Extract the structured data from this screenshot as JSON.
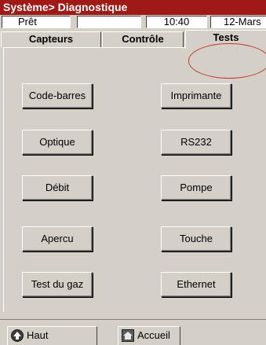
{
  "titlebar": {
    "title": "Système> Diagnostique"
  },
  "status": {
    "state": "Prêt",
    "blank": "",
    "time": "10:40",
    "date": "12-Mars"
  },
  "tabs": [
    {
      "label": "Capteurs",
      "active": false
    },
    {
      "label": "Contrôle",
      "active": false
    },
    {
      "label": "Tests",
      "active": true
    }
  ],
  "tests": {
    "buttons": [
      "Code-barres",
      "Imprimante",
      "Optique",
      "RS232",
      "Débit",
      "Pompe",
      "Apercu",
      "Touche",
      "Test du gaz",
      "Ethernet"
    ]
  },
  "footer": {
    "up_label": "Haut",
    "home_label": "Accueil"
  },
  "colors": {
    "titlebar": "#9f1a16",
    "panel": "#d4d0c8",
    "highlight": "#c0392b"
  },
  "icons": {
    "up": "up-arrow-icon",
    "home": "home-icon"
  }
}
